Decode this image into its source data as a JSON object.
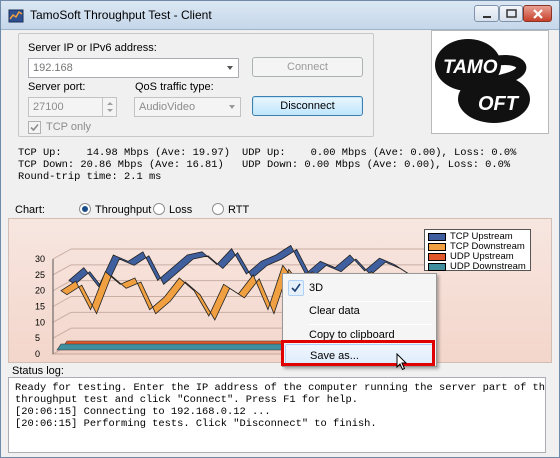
{
  "window": {
    "title": "TamoSoft Throughput Test - Client"
  },
  "server": {
    "ip_label": "Server IP or IPv6  address:",
    "ip_value": "192.168",
    "connect_label": "Connect",
    "port_label": "Server port:",
    "port_value": "27100",
    "qos_label": "QoS traffic type:",
    "qos_value": "AudioVideo",
    "disconnect_label": "Disconnect",
    "tcp_only_label": "TCP only",
    "tcp_only_checked": true
  },
  "logo": {
    "text_top": "TAMO",
    "text_bottom": "OFT",
    "letter": "S"
  },
  "stats": {
    "tcp_up": "TCP Up:    14.98 Mbps (Ave: 19.97)",
    "tcp_down": "TCP Down: 20.86 Mbps (Ave: 16.81)",
    "rtt": "Round-trip time: 2.1 ms",
    "udp_up": "UDP Up:    0.00 Mbps (Ave: 0.00), Loss: 0.0%",
    "udp_down": "UDP Down: 0.00 Mbps (Ave: 0.00), Loss: 0.0%"
  },
  "chart_selector": {
    "label": "Chart:",
    "options": [
      "Throughput",
      "Loss",
      "RTT"
    ],
    "selected": "Throughput"
  },
  "chart_data": {
    "type": "line",
    "yticks": [
      "0",
      "5",
      "10",
      "15",
      "20",
      "25",
      "30"
    ],
    "ylim": [
      0,
      30
    ],
    "legend": [
      "TCP Upstream",
      "TCP Downstream",
      "UDP Upstream",
      "UDP Downstream"
    ],
    "colors": {
      "tcp_up": "#3f5f9f",
      "tcp_down": "#f0a040",
      "udp_up": "#e0572a",
      "udp_down": "#3f8f9f"
    },
    "series": [
      {
        "name": "TCP Upstream",
        "values": [
          22,
          26,
          20,
          30,
          28,
          31,
          22,
          26,
          30,
          31,
          27,
          32,
          24,
          28,
          30,
          33,
          24,
          28,
          26,
          30,
          25,
          29,
          27,
          24
        ]
      },
      {
        "name": "TCP Downstream",
        "values": [
          20,
          23,
          14,
          26,
          22,
          24,
          14,
          18,
          24,
          20,
          12,
          22,
          19,
          25,
          14,
          28,
          22,
          26,
          20,
          24,
          22,
          26,
          22,
          20
        ]
      },
      {
        "name": "UDP Upstream",
        "values": [
          0,
          0,
          0,
          0,
          0,
          0,
          0,
          0,
          0,
          0,
          0,
          0,
          0,
          0,
          0,
          0,
          0,
          0,
          0,
          0,
          0,
          0,
          0,
          0
        ]
      },
      {
        "name": "UDP Downstream",
        "values": [
          0,
          0,
          0,
          0,
          0,
          0,
          0,
          0,
          0,
          0,
          0,
          0,
          0,
          0,
          0,
          0,
          0,
          0,
          0,
          0,
          0,
          0,
          0,
          0
        ]
      }
    ]
  },
  "context_menu": {
    "items": [
      "3D",
      "Clear data",
      "Copy to clipboard",
      "Save as..."
    ],
    "checked": "3D",
    "hovered": "Save as..."
  },
  "status": {
    "label": "Status log:",
    "lines": [
      "Ready for testing. Enter the IP address of the computer running the server part of the",
      "throughput test and click \"Connect\". Press F1 for help.",
      "[20:06:15] Connecting to 192.168.0.12 ...",
      "[20:06:15] Performing tests. Click \"Disconnect\" to finish."
    ]
  }
}
